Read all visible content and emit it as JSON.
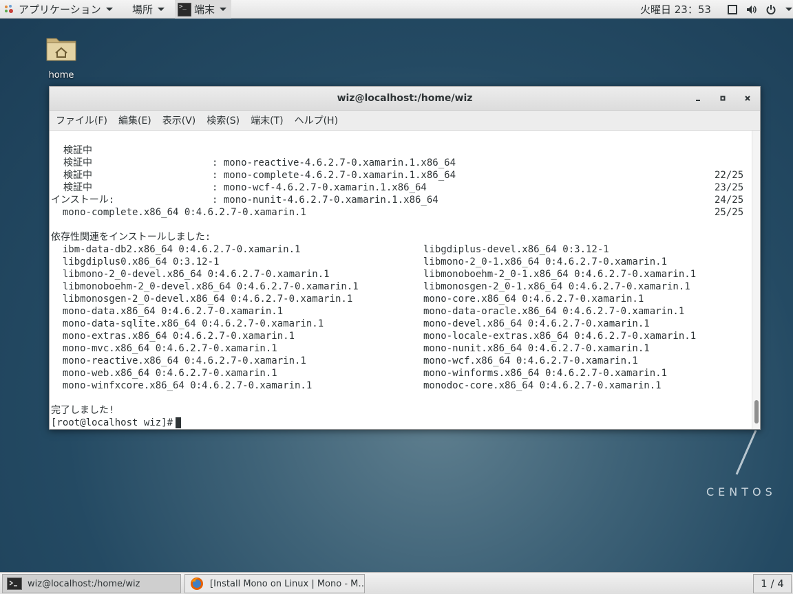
{
  "top_panel": {
    "applications": "アプリケーション",
    "places": "場所",
    "terminal": "端末",
    "clock": "火曜日 23：53"
  },
  "desktop": {
    "home_label": "home",
    "centos": "CENTOS"
  },
  "window": {
    "title": "wiz@localhost:/home/wiz",
    "menu": [
      "ファイル(F)",
      "編集(E)",
      "表示(V)",
      "検索(S)",
      "端末(T)",
      "ヘルプ(H)"
    ]
  },
  "terminal": {
    "verify_rows": [
      {
        "label": "検証中",
        "pkg": ": mono-reactive-4.6.2.7-0.xamarin.1.x86_64",
        "ratio": "22/25"
      },
      {
        "label": "検証中",
        "pkg": ": mono-complete-4.6.2.7-0.xamarin.1.x86_64",
        "ratio": "23/25"
      },
      {
        "label": "検証中",
        "pkg": ": mono-wcf-4.6.2.7-0.xamarin.1.x86_64",
        "ratio": "24/25"
      },
      {
        "label": "検証中",
        "pkg": ": mono-nunit-4.6.2.7-0.xamarin.1.x86_64",
        "ratio": "25/25"
      }
    ],
    "install_header": "インストール:",
    "install_pkg": "  mono-complete.x86_64 0:4.6.2.7-0.xamarin.1",
    "deps_header": "依存性関連をインストールしました:",
    "deps_left": [
      "  ibm-data-db2.x86_64 0:4.6.2.7-0.xamarin.1",
      "  libgdiplus0.x86_64 0:3.12-1",
      "  libmono-2_0-devel.x86_64 0:4.6.2.7-0.xamarin.1",
      "  libmonoboehm-2_0-devel.x86_64 0:4.6.2.7-0.xamarin.1",
      "  libmonosgen-2_0-devel.x86_64 0:4.6.2.7-0.xamarin.1",
      "  mono-data.x86_64 0:4.6.2.7-0.xamarin.1",
      "  mono-data-sqlite.x86_64 0:4.6.2.7-0.xamarin.1",
      "  mono-extras.x86_64 0:4.6.2.7-0.xamarin.1",
      "  mono-mvc.x86_64 0:4.6.2.7-0.xamarin.1",
      "  mono-reactive.x86_64 0:4.6.2.7-0.xamarin.1",
      "  mono-web.x86_64 0:4.6.2.7-0.xamarin.1",
      "  mono-winfxcore.x86_64 0:4.6.2.7-0.xamarin.1"
    ],
    "deps_right": [
      "libgdiplus-devel.x86_64 0:3.12-1",
      "libmono-2_0-1.x86_64 0:4.6.2.7-0.xamarin.1",
      "libmonoboehm-2_0-1.x86_64 0:4.6.2.7-0.xamarin.1",
      "libmonosgen-2_0-1.x86_64 0:4.6.2.7-0.xamarin.1",
      "mono-core.x86_64 0:4.6.2.7-0.xamarin.1",
      "mono-data-oracle.x86_64 0:4.6.2.7-0.xamarin.1",
      "mono-devel.x86_64 0:4.6.2.7-0.xamarin.1",
      "mono-locale-extras.x86_64 0:4.6.2.7-0.xamarin.1",
      "mono-nunit.x86_64 0:4.6.2.7-0.xamarin.1",
      "mono-wcf.x86_64 0:4.6.2.7-0.xamarin.1",
      "mono-winforms.x86_64 0:4.6.2.7-0.xamarin.1",
      "monodoc-core.x86_64 0:4.6.2.7-0.xamarin.1"
    ],
    "complete": "完了しました!",
    "prompt": "[root@localhost wiz]#"
  },
  "taskbar": {
    "task_terminal": "wiz@localhost:/home/wiz",
    "task_firefox": "[Install Mono on Linux | Mono - M…",
    "workspace": "1 / 4"
  }
}
